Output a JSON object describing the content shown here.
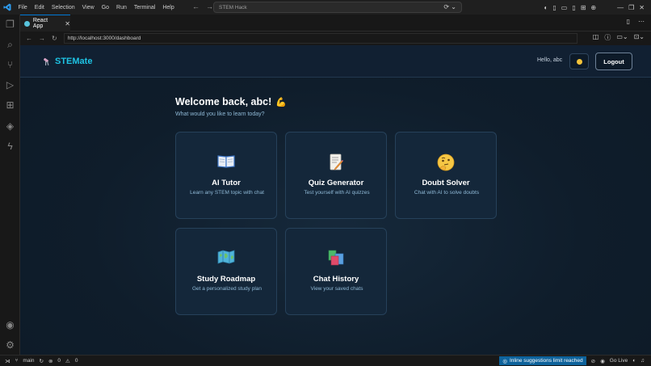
{
  "titlebar": {
    "menu": [
      "File",
      "Edit",
      "Selection",
      "View",
      "Go",
      "Run",
      "Terminal",
      "Help"
    ],
    "search_text": "STEM Hack"
  },
  "tab": {
    "label": "React App"
  },
  "browser": {
    "url": "http://localhost:3000/dashboard"
  },
  "app": {
    "brand": "STEMate",
    "greeting": "Hello, abc",
    "logout_label": "Logout",
    "welcome_title": "Welcome back, abc!",
    "welcome_emoji": "💪",
    "subtitle": "What would you like to learn today?",
    "cards": [
      {
        "title": "AI Tutor",
        "desc": "Learn any STEM topic with chat",
        "icon": "book-icon"
      },
      {
        "title": "Quiz Generator",
        "desc": "Test yourself with AI quizzes",
        "icon": "memo-icon"
      },
      {
        "title": "Doubt Solver",
        "desc": "Chat with AI to solve doubts",
        "icon": "thinking-face-icon"
      },
      {
        "title": "Study Roadmap",
        "desc": "Get a personalized study plan",
        "icon": "map-icon"
      },
      {
        "title": "Chat History",
        "desc": "View your saved chats",
        "icon": "books-icon"
      }
    ]
  },
  "statusbar": {
    "branch": "main",
    "errors": "0",
    "warnings": "0",
    "inline_suggestions": "Inline suggestions limit reached",
    "go_live": "Go Live"
  },
  "colors": {
    "brand": "#1ec3e4",
    "background": "#0f1d2b",
    "card": "#14273a",
    "accent_status": "#0e639c"
  }
}
